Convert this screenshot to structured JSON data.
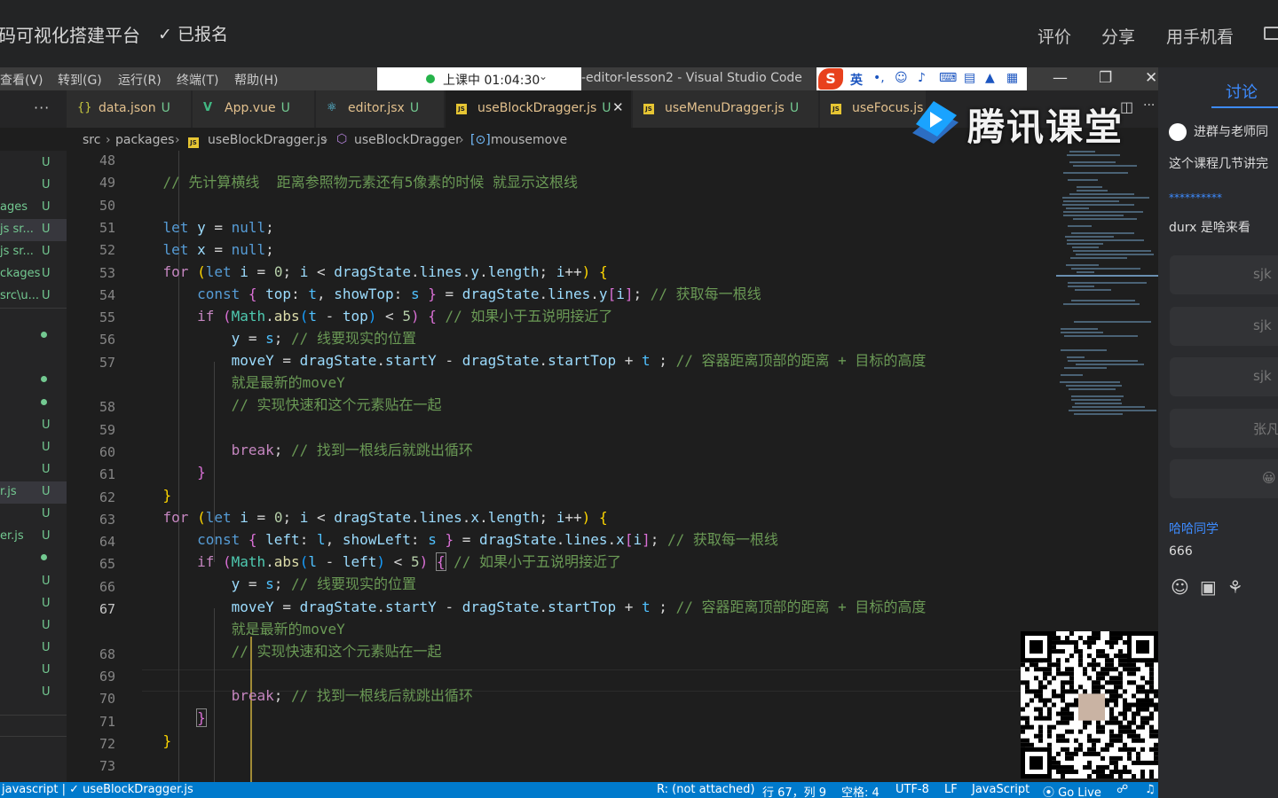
{
  "topbar": {
    "title": "码可视化搭建平台",
    "enrolled": "✓ 已报名",
    "actions": [
      "评价",
      "分享",
      "用手机看"
    ]
  },
  "vscode": {
    "menu": [
      "查看(V)",
      "转到(G)",
      "运行(R)",
      "终端(T)",
      "帮助(H)"
    ],
    "live_status": "上课中 01:04:30",
    "window_title": "-editor-lesson2 - Visual Studio Code",
    "ime_label": "英",
    "tabs": [
      {
        "icon": "{}",
        "label": "data.json",
        "status": "U",
        "active": false
      },
      {
        "icon": "V",
        "label": "App.vue",
        "status": "U",
        "active": false
      },
      {
        "icon": "⚛",
        "label": "editor.jsx",
        "status": "U",
        "active": false
      },
      {
        "icon": "JS",
        "label": "useBlockDragger.js",
        "status": "U",
        "active": true
      },
      {
        "icon": "JS",
        "label": "useMenuDragger.js",
        "status": "U",
        "active": false
      },
      {
        "icon": "JS",
        "label": "useFocus.js",
        "status": "",
        "active": false
      }
    ],
    "breadcrumb": [
      "src",
      "packages",
      "useBlockDragger.js",
      "useBlockDragger",
      "mousemove"
    ],
    "explorer_rows": [
      {
        "name": "",
        "status": "U"
      },
      {
        "name": "",
        "status": "U"
      },
      {
        "name": "ages",
        "status": "U"
      },
      {
        "name": "js sr...",
        "status": "U"
      },
      {
        "name": "js sr...",
        "status": "U"
      },
      {
        "name": "ckages",
        "status": "U"
      },
      {
        "name": "src\\u...",
        "status": "U"
      }
    ],
    "explorer_lower": [
      {
        "name": "",
        "status": "U"
      },
      {
        "name": "",
        "status": "U"
      },
      {
        "name": "",
        "status": "U"
      },
      {
        "name": "r.js",
        "status": "U"
      },
      {
        "name": "",
        "status": "U"
      },
      {
        "name": "er.js",
        "status": "U"
      },
      {
        "name": "",
        "status": "U"
      },
      {
        "name": "",
        "status": "U"
      },
      {
        "name": "",
        "status": "U"
      },
      {
        "name": "",
        "status": "U"
      },
      {
        "name": "",
        "status": "U"
      },
      {
        "name": "",
        "status": "U"
      }
    ],
    "line_numbers": [
      "48",
      "49",
      "50",
      "51",
      "52",
      "53",
      "54",
      "55",
      "56",
      "57",
      "",
      "58",
      "59",
      "60",
      "61",
      "62",
      "63",
      "64",
      "65",
      "66",
      "67",
      "",
      "68",
      "69",
      "70",
      "71",
      "72",
      "73"
    ],
    "current_line": "67",
    "status_bar": {
      "left": "javascript | ✓ useBlockDragger.js",
      "attach": "R: (not attached)",
      "position": "行 67，列 9",
      "indent": "空格: 4",
      "encoding": "UTF-8",
      "eol": "LF",
      "language": "JavaScript",
      "golive": "Go Live"
    }
  },
  "watermark": "腾讯课堂",
  "discussion": {
    "header": "讨论",
    "notice": "进群与老师同",
    "messages": [
      {
        "text": "这个课程几节讲完"
      },
      {
        "text": "**********",
        "highlight": true
      },
      {
        "text": "durx 是啥来看"
      }
    ],
    "bubbles": [
      "sjk",
      "sjk",
      "sjk",
      "张凡",
      "😀"
    ],
    "last_sender": "哈哈同学",
    "last_message": "666"
  }
}
